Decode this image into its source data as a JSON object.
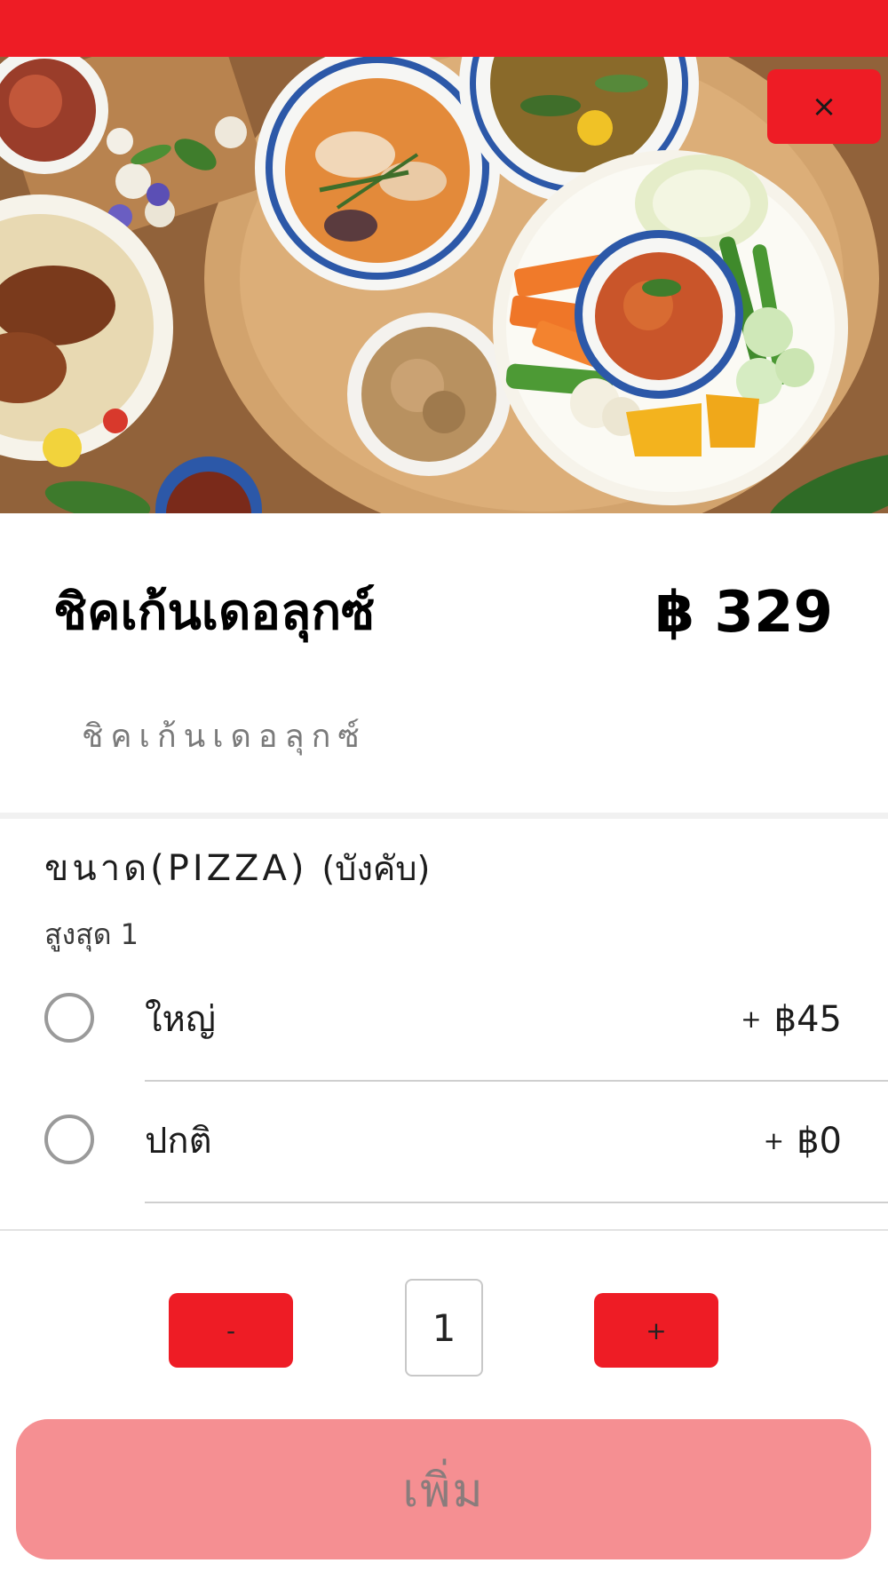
{
  "colors": {
    "brand_red": "#ee1c25",
    "add_button_disabled": "#f58f92",
    "hero_background": "#b07a4a"
  },
  "header": {
    "close_icon": "×"
  },
  "hero": {
    "image_name": "food-photo"
  },
  "item": {
    "title": "ชิคเก้นเดอลุกซ์",
    "price": "฿ 329",
    "description": "ชิคเก้นเดอลุกซ์"
  },
  "option_group": {
    "name": "ขนาด(PIZZA)",
    "required_label": "(บังคับ)",
    "max_label": "สูงสุด 1",
    "options": [
      {
        "label": "ใหญ่",
        "plus": "+",
        "price": "฿45",
        "selected": false
      },
      {
        "label": "ปกติ",
        "plus": "+",
        "price": "฿0",
        "selected": false
      }
    ]
  },
  "quantity": {
    "minus_label": "-",
    "value": "1",
    "plus_label": "+"
  },
  "add_button": {
    "label": "เพิ่ม"
  }
}
